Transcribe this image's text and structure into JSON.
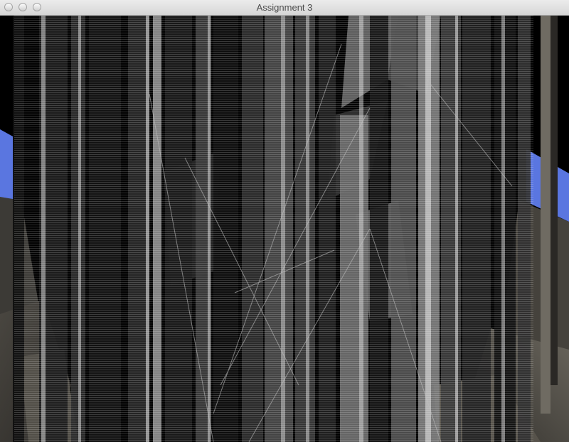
{
  "window": {
    "title": "Assignment 3",
    "buttons": [
      "close",
      "minimize",
      "zoom"
    ]
  },
  "scene": {
    "description_colors": {
      "sky": "#5a76e0",
      "stone": "#5b5953",
      "stone_dark": "#2f2e2b",
      "pillar_light": "#cfcfcf",
      "pillar_dark": "#1a1a1a"
    }
  }
}
